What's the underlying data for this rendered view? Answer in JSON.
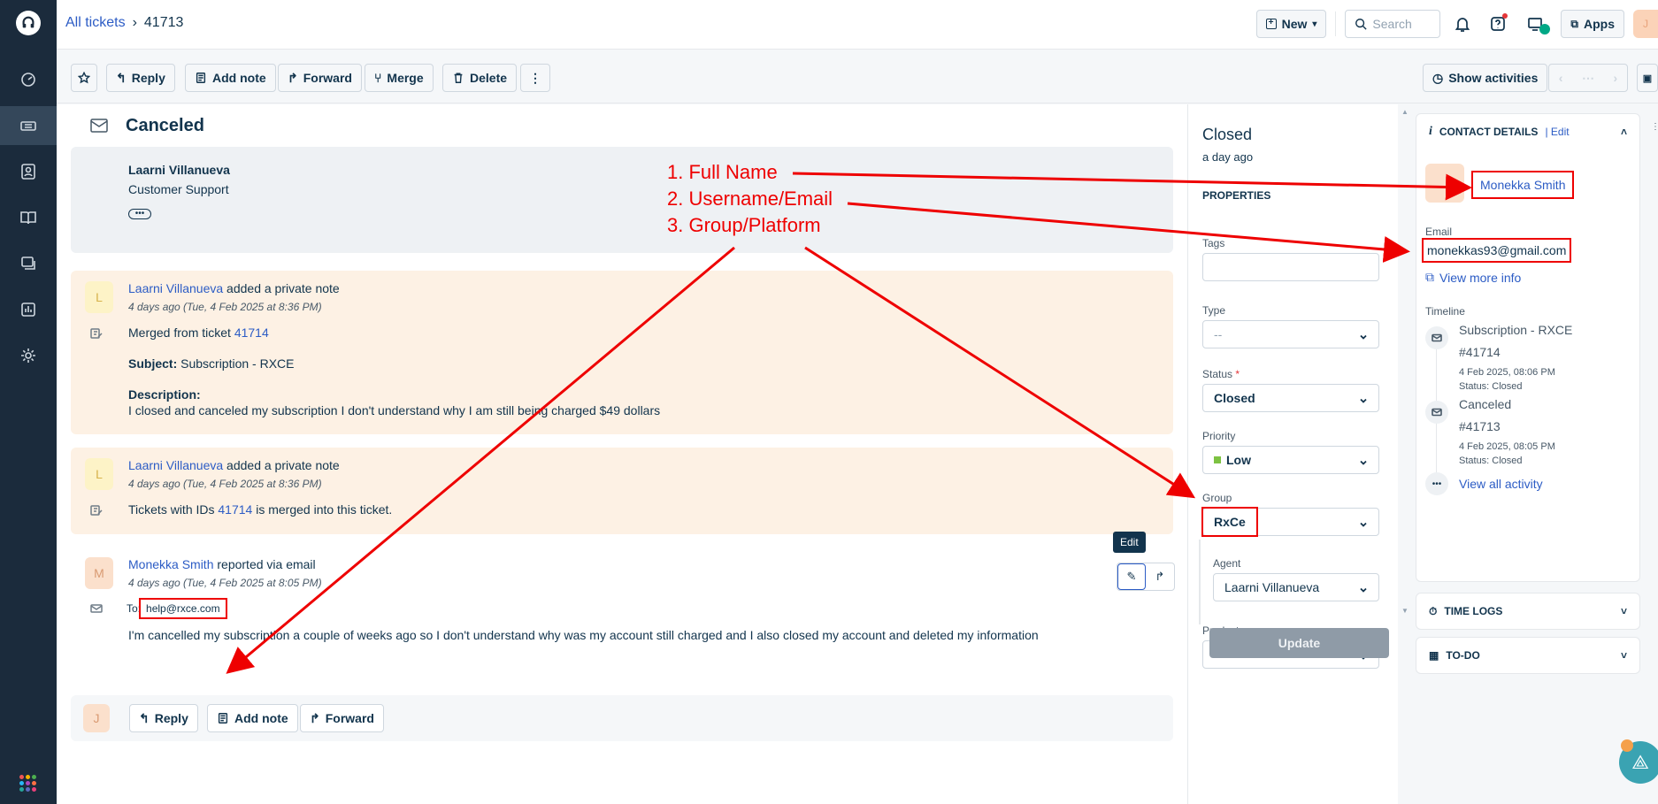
{
  "topbar": {
    "breadcrumb_root": "All tickets",
    "ticket_id": "41713",
    "new_label": "New",
    "search_placeholder": "Search",
    "apps_label": "Apps",
    "avatar_initial": "J"
  },
  "toolbar": {
    "reply": "Reply",
    "add_note": "Add note",
    "forward": "Forward",
    "merge": "Merge",
    "delete": "Delete",
    "show_activities": "Show activities"
  },
  "ticket": {
    "subject": "Canceled",
    "agent_card": {
      "name": "Laarni Villanueva",
      "role": "Customer Support"
    },
    "note1": {
      "avatar": "L",
      "author": "Laarni Villanueva",
      "action": "added a private note",
      "time": "4 days ago (Tue, 4 Feb 2025 at 8:36 PM)",
      "merged_prefix": "Merged from ticket",
      "merged_id": "41714",
      "subject_label": "Subject:",
      "subject_value": "Subscription - RXCE",
      "description_label": "Description:",
      "description": "I closed and canceled my subscription I don't understand why I am still being charged $49 dollars"
    },
    "note2": {
      "avatar": "L",
      "author": "Laarni Villanueva",
      "action": "added a private note",
      "time": "4 days ago (Tue, 4 Feb 2025 at 8:36 PM)",
      "text_prefix": "Tickets with IDs",
      "merged_id": "41714",
      "text_suffix": "is merged into this ticket."
    },
    "email": {
      "avatar": "M",
      "author": "Monekka Smith",
      "action": "reported via email",
      "time": "4 days ago (Tue, 4 Feb 2025 at 8:05 PM)",
      "to_label": "To:",
      "to_value": "help@rxce.com",
      "body": "I'm cancelled my subscription a couple of weeks ago so I don't understand why was my account still charged and I also closed my account and deleted my information",
      "edit_tooltip": "Edit"
    },
    "reply_bar": {
      "avatar": "J",
      "reply": "Reply",
      "add_note": "Add note",
      "forward": "Forward"
    }
  },
  "annotations": {
    "line1": "1. Full Name",
    "line2": "2. Username/Email",
    "line3": "3. Group/Platform",
    "color": "#e00000"
  },
  "properties": {
    "status_title": "Closed",
    "status_time": "a day ago",
    "heading": "PROPERTIES",
    "tags_label": "Tags",
    "type_label": "Type",
    "type_value": "--",
    "status_label": "Status",
    "status_required": "*",
    "status_value": "Closed",
    "priority_label": "Priority",
    "priority_value": "Low",
    "priority_color": "#7dc242",
    "group_label": "Group",
    "group_value": "RxCe",
    "agent_label": "Agent",
    "agent_value": "Laarni Villanueva",
    "product_label": "Product",
    "product_value": "--",
    "update_label": "Update"
  },
  "contact": {
    "heading": "CONTACT DETAILS",
    "edit": "Edit",
    "name": "Monekka Smith",
    "email_label": "Email",
    "email": "monekkas93@gmail.com",
    "view_more": "View more info",
    "timeline_label": "Timeline",
    "timeline": [
      {
        "title": "Subscription - RXCE",
        "id": "#41714",
        "date": "4 Feb 2025, 08:06 PM",
        "status": "Status: Closed"
      },
      {
        "title": "Canceled",
        "id": "#41713",
        "date": "4 Feb 2025, 08:05 PM",
        "status": "Status: Closed"
      }
    ],
    "view_all": "View all activity",
    "time_logs": "TIME LOGS",
    "todo": "TO-DO"
  }
}
